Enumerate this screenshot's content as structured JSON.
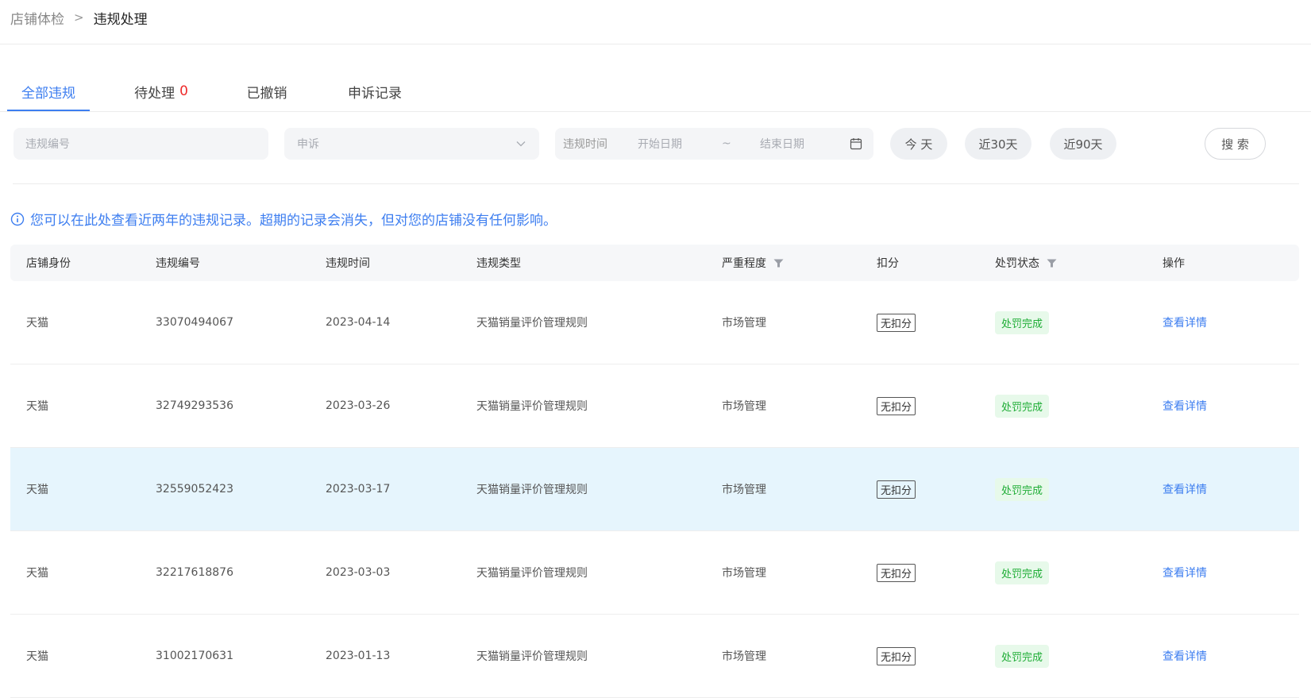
{
  "breadcrumb": {
    "root": "店铺体检",
    "separator": ">",
    "current": "违规处理"
  },
  "tabs": [
    {
      "label": "全部违规",
      "active": true
    },
    {
      "label": "待处理",
      "count": "0"
    },
    {
      "label": "已撤销"
    },
    {
      "label": "申诉记录"
    }
  ],
  "filters": {
    "violation_id_placeholder": "违规编号",
    "appeal_placeholder": "申诉",
    "date_label": "违规时间",
    "start_placeholder": "开始日期",
    "date_separator": "~",
    "end_placeholder": "结束日期",
    "quick_ranges": [
      "今 天",
      "近30天",
      "近90天"
    ],
    "search_label": "搜 索"
  },
  "notice": "您可以在此处查看近两年的违规记录。超期的记录会消失，但对您的店铺没有任何影响。",
  "table": {
    "columns": [
      "店铺身份",
      "违规编号",
      "违规时间",
      "违规类型",
      "严重程度",
      "扣分",
      "处罚状态",
      "操作"
    ],
    "rows": [
      {
        "shop": "天猫",
        "id": "33070494067",
        "date": "2023-04-14",
        "type": "天猫销量评价管理规则",
        "severity": "市场管理",
        "deduct": "无扣分",
        "status": "处罚完成",
        "action": "查看详情"
      },
      {
        "shop": "天猫",
        "id": "32749293536",
        "date": "2023-03-26",
        "type": "天猫销量评价管理规则",
        "severity": "市场管理",
        "deduct": "无扣分",
        "status": "处罚完成",
        "action": "查看详情"
      },
      {
        "shop": "天猫",
        "id": "32559052423",
        "date": "2023-03-17",
        "type": "天猫销量评价管理规则",
        "severity": "市场管理",
        "deduct": "无扣分",
        "status": "处罚完成",
        "action": "查看详情"
      },
      {
        "shop": "天猫",
        "id": "32217618876",
        "date": "2023-03-03",
        "type": "天猫销量评价管理规则",
        "severity": "市场管理",
        "deduct": "无扣分",
        "status": "处罚完成",
        "action": "查看详情"
      },
      {
        "shop": "天猫",
        "id": "31002170631",
        "date": "2023-01-13",
        "type": "天猫销量评价管理规则",
        "severity": "市场管理",
        "deduct": "无扣分",
        "status": "处罚完成",
        "action": "查看详情"
      }
    ]
  },
  "colors": {
    "accent": "#3d7ef0",
    "alert": "#ee2b2b",
    "success": "#1fad36",
    "row_highlight": "#e6f5fd"
  },
  "icons": {
    "dropdown": "chevron-down-icon",
    "calendar": "calendar-icon",
    "info": "info-icon",
    "filter": "filter-funnel-icon"
  }
}
